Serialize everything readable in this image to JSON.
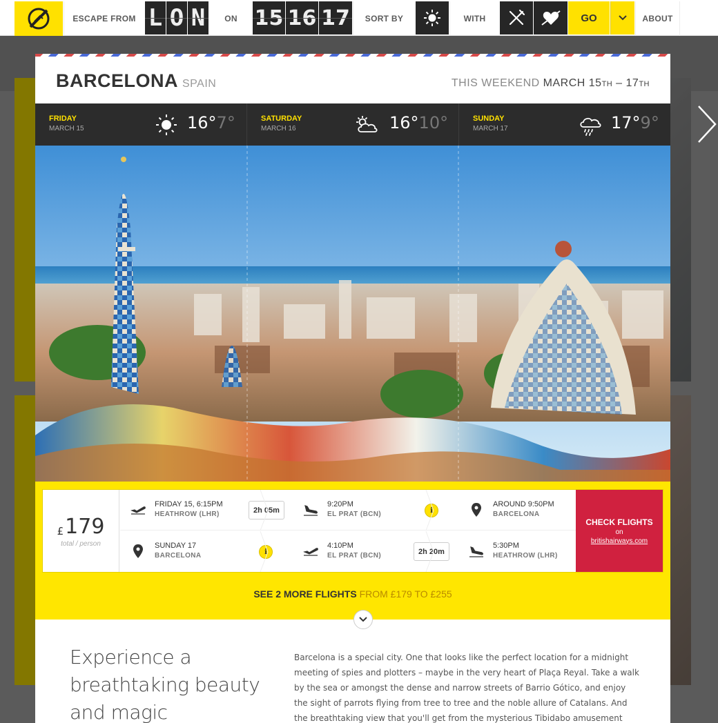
{
  "nav": {
    "escape_label": "ESCAPE FROM",
    "origin_letters": [
      "L",
      "O",
      "N"
    ],
    "on_label": "ON",
    "dates": [
      "15",
      "16",
      "17"
    ],
    "sort_label": "SORT BY",
    "with_label": "WITH",
    "go_label": "GO",
    "about_label": "ABOUT"
  },
  "destination": {
    "city": "BARCELONA",
    "country": "SPAIN",
    "weekend_prefix": "THIS WEEKEND",
    "weekend_range": "MARCH 15",
    "weekend_suffix1": "TH",
    "weekend_dash": " – 17",
    "weekend_suffix2": "TH"
  },
  "weather": [
    {
      "day": "FRIDAY",
      "date": "MARCH 15",
      "icon": "sun-icon",
      "high": "16°",
      "low": "7°"
    },
    {
      "day": "SATURDAY",
      "date": "MARCH 16",
      "icon": "sun-cloud-icon",
      "high": "16°",
      "low": "10°"
    },
    {
      "day": "SUNDAY",
      "date": "MARCH 17",
      "icon": "rain-cloud-icon",
      "high": "17°",
      "low": "9°"
    }
  ],
  "price": {
    "currency": "£",
    "amount": "179",
    "unit": "total / person"
  },
  "outbound": {
    "depart_time": "FRIDAY 15, 6:15PM",
    "depart_place": "HEATHROW (LHR)",
    "duration": "2h 05m",
    "arrive_time": "9:20PM",
    "arrive_place": "EL PRAT (BCN)",
    "dest_time": "AROUND 9:50PM",
    "dest_place": "BARCELONA"
  },
  "return": {
    "depart_time": "SUNDAY 17",
    "depart_place": "BARCELONA",
    "airport_time": "4:10PM",
    "airport_place": "EL PRAT (BCN)",
    "duration": "2h 20m",
    "arrive_time": "5:30PM",
    "arrive_place": "HEATHROW (LHR)"
  },
  "info_glyph": "i",
  "check": {
    "label": "CHECK FLIGHTS",
    "on": "on",
    "link": "britishairways.com"
  },
  "more": {
    "prefix": "SEE 2 MORE FLIGHTS",
    "range": "FROM £179 TO £255"
  },
  "description": {
    "headline": "Experience a breathtaking beauty and magic",
    "body": "Barcelona is a special city. One that looks like the perfect location for a midnight meeting of spies and plotters – maybe in the very heart of Plaça Reyal. Take a walk by the sea or amongst the dense and narrow streets of Barrio Gótico, and enjoy the sight of parrots flying from tree to tree and the noble allure of Catalans. And the breathtaking view that you'll get from the mysterious Tibidabo amusement park, will"
  },
  "colors": {
    "accent": "#ffe100",
    "cta": "#d0213f",
    "dark": "#2c2c2c"
  }
}
